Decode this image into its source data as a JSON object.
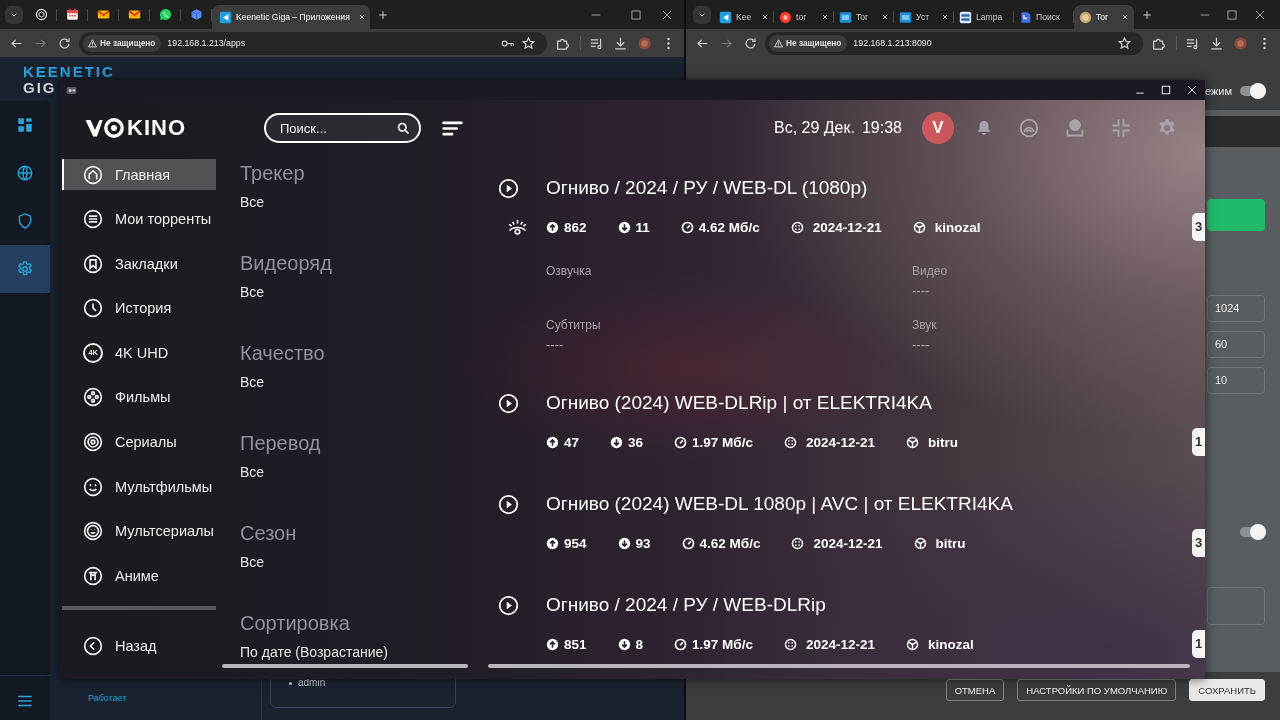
{
  "left_browser": {
    "tabs": [
      {
        "selected": false
      },
      {
        "selected": false
      },
      {
        "selected": false
      },
      {
        "selected": false
      },
      {
        "selected": false
      },
      {
        "selected": false
      },
      {
        "title": "Keenetic Giga – Приложения",
        "selected": true,
        "close_button": true
      }
    ],
    "address_bar": {
      "security": "Не защищено",
      "url": "192.168.1.213/apps"
    },
    "page": {
      "logo": [
        "KEENETIC",
        "GIG"
      ],
      "nav": [
        {
          "selected": false
        },
        {
          "selected": false
        },
        {
          "selected": false
        },
        {
          "selected": true
        }
      ],
      "status": "Работает",
      "user": "admin"
    }
  },
  "right_browser": {
    "tabs": [
      {
        "title": "Kee",
        "selected": false,
        "close_button": true
      },
      {
        "title": "tor",
        "selected": false,
        "close_button": true
      },
      {
        "title": "Tor",
        "selected": false,
        "close_button": true
      },
      {
        "title": "Уст",
        "selected": false,
        "close_button": true
      },
      {
        "title": "Lampa",
        "selected": false,
        "close_button": false
      },
      {
        "title": "Поиск",
        "selected": false,
        "close_button": false
      },
      {
        "title": "Tor",
        "selected": true,
        "close_button": true
      }
    ],
    "address_bar": {
      "security": "Не защищено",
      "url": "192.168.1.213:8090"
    },
    "page": {
      "mode": {
        "label": "ежим",
        "on": true
      },
      "fields": [
        "1024",
        "60",
        "10"
      ],
      "switch": {
        "on": true
      },
      "buttons": [
        {
          "label": "ОТМЕНА",
          "primary": false
        },
        {
          "label": "НАСТРОЙКИ ПО УМОЛЧАНИЮ",
          "primary": false
        },
        {
          "label": "СОХРАНИТЬ",
          "primary": true
        }
      ]
    }
  },
  "app": {
    "logo": "KINO",
    "search": {
      "placeholder": "Поиск..."
    },
    "date": "Вс, 29 Дек.",
    "time": "19:38",
    "avatar": "V",
    "sidebar": [
      {
        "label": "Главная",
        "selected": true
      },
      {
        "label": "Мои торренты",
        "selected": false
      },
      {
        "label": "Закладки",
        "selected": false
      },
      {
        "label": "История",
        "selected": false
      },
      {
        "label": "4K UHD",
        "icon_text": "4K",
        "selected": false
      },
      {
        "label": "Фильмы",
        "selected": false
      },
      {
        "label": "Сериалы",
        "selected": false
      },
      {
        "label": "Мультфильмы",
        "selected": false
      },
      {
        "label": "Мультсериалы",
        "selected": false
      },
      {
        "label": "Аниме",
        "selected": false
      }
    ],
    "back": "Назад",
    "filters": [
      {
        "title": "Трекер",
        "value": "Все"
      },
      {
        "title": "Видеоряд",
        "value": "Все"
      },
      {
        "title": "Качество",
        "value": "Все"
      },
      {
        "title": "Перевод",
        "value": "Все"
      },
      {
        "title": "Сезон",
        "value": "Все"
      },
      {
        "title": "Сортировка",
        "value": "По дате (Возрастание)"
      }
    ],
    "results": [
      {
        "title": "Огниво / 2024 / РУ / WEB-DL (1080p)",
        "seeders": "862",
        "leechers": "11",
        "speed": "4.62 Мб/с",
        "date": "2024-12-21",
        "tracker": "kinozal",
        "badge": "3",
        "details": [
          {
            "label": "Озвучка"
          },
          {
            "label": "Видео",
            "value": "----"
          },
          {
            "label": "Субтитры",
            "value": "----"
          },
          {
            "label": "Звук",
            "value": "----"
          }
        ]
      },
      {
        "title": "Огниво (2024) WEB-DLRip | от ELEKTRI4KA",
        "seeders": "47",
        "leechers": "36",
        "speed": "1.97 Мб/с",
        "date": "2024-12-21",
        "tracker": "bitru",
        "badge": "1"
      },
      {
        "title": "Огниво (2024) WEB-DL 1080p | AVC | от ELEKTRI4KA",
        "seeders": "954",
        "leechers": "93",
        "speed": "4.62 Мб/с",
        "date": "2024-12-21",
        "tracker": "bitru",
        "badge": "3"
      },
      {
        "title": "Огниво / 2024 / РУ / WEB-DLRip",
        "seeders": "851",
        "leechers": "8",
        "speed": "1.97 Мб/с",
        "date": "2024-12-21",
        "tracker": "kinozal",
        "badge": "1"
      }
    ]
  }
}
